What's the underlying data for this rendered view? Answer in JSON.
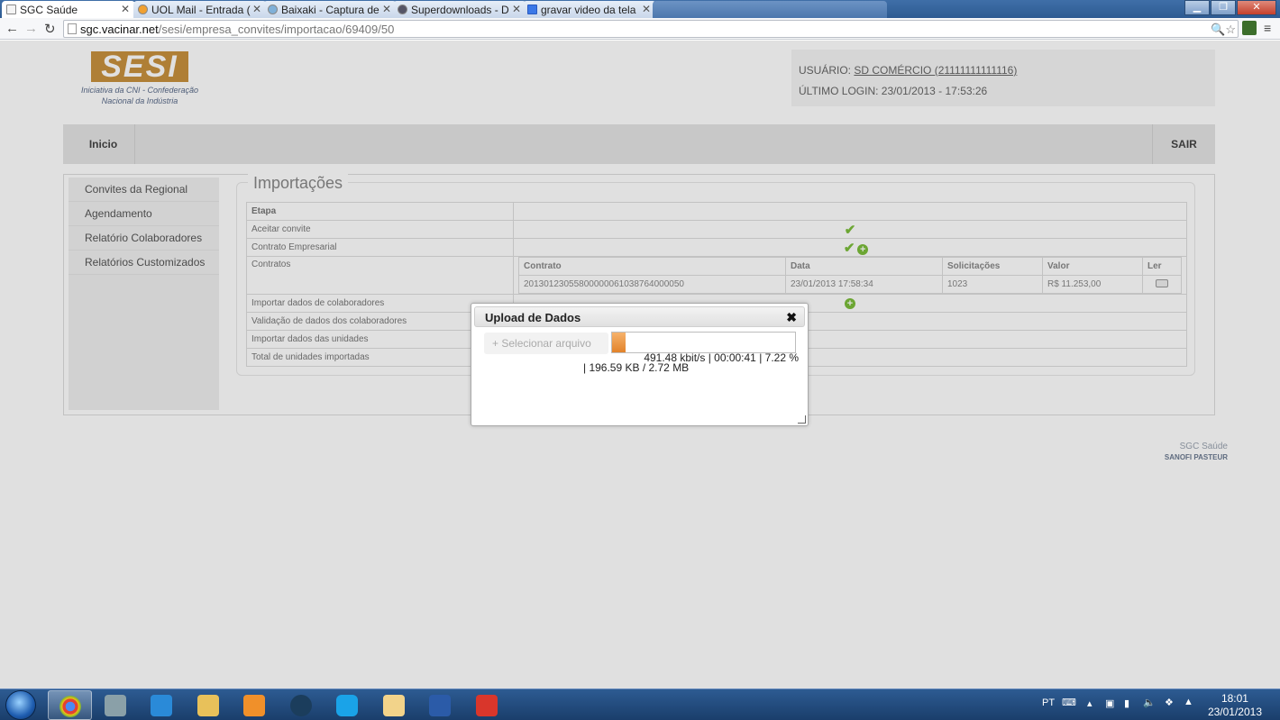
{
  "browser": {
    "tabs": [
      {
        "title": "SGC Saúde",
        "active": true
      },
      {
        "title": "UOL Mail - Entrada (",
        "active": false
      },
      {
        "title": "Baixaki - Captura de",
        "active": false
      },
      {
        "title": "Superdownloads - D",
        "active": false
      },
      {
        "title": "gravar video da tela",
        "active": false
      }
    ],
    "url_host": "sgc.vacinar.net",
    "url_path": "/sesi/empresa_convites/importacao/69409/50"
  },
  "header": {
    "logo_text": "SESI",
    "logo_sub_line1": "Iniciativa da CNI - Confederação",
    "logo_sub_line2": "Nacional da Indústria",
    "user_label": "USUÁRIO:",
    "user_name": "SD COMÉRCIO (21111111111116)",
    "last_login": "ÚLTIMO LOGIN: 23/01/2013 - 17:53:26"
  },
  "menu": {
    "home": "Inicio",
    "exit": "SAIR"
  },
  "sidebar": {
    "items": [
      {
        "label": "Convites da Regional"
      },
      {
        "label": "Agendamento"
      },
      {
        "label": "Relatório Colaboradores"
      },
      {
        "label": "Relatórios Customizados"
      }
    ]
  },
  "main": {
    "title": "Importações",
    "etapa_header": "Etapa",
    "rows": {
      "r0": "Aceitar convite",
      "r1": "Contrato Empresarial",
      "r2": "Contratos",
      "r3": "Importar dados de colaboradores",
      "r4": "Validação de dados dos colaboradores",
      "r5": "Importar dados das unidades",
      "r6": "Total de unidades importadas"
    },
    "contract_table": {
      "headers": {
        "contrato": "Contrato",
        "data": "Data",
        "solicitacoes": "Solicitações",
        "valor": "Valor",
        "ler": "Ler"
      },
      "row": {
        "contrato": "20130123055800000061038764000050",
        "data": "23/01/2013 17:58:34",
        "solicitacoes": "1023",
        "valor": "R$ 11.253,00"
      }
    }
  },
  "dialog": {
    "title": "Upload de Dados",
    "close": "✖",
    "select_button": "Selecionar arquivo",
    "progress_fraction": 0.0722,
    "status_line1": "491.48 kbit/s | 00:00:41 | 7.22 %",
    "status_line2": "| 196.59 KB / 2.72 MB"
  },
  "footer": {
    "brand": "SGC Saúde",
    "brand2": "SANOFI PASTEUR"
  },
  "taskbar": {
    "language": "PT",
    "time": "18:01",
    "date": "23/01/2013"
  },
  "colors": {
    "accent": "#c8913e",
    "progress": "#e2832a",
    "check": "#7cbd3b"
  }
}
